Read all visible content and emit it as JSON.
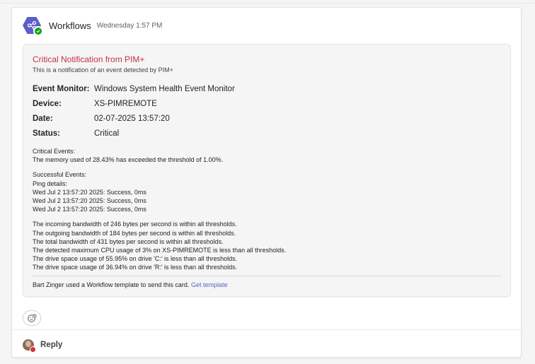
{
  "message": {
    "sender": "Workflows",
    "timestamp": "Wednesday 1:57 PM",
    "icons": {
      "avatar": "workflow-share-icon",
      "presence": "available-check-icon"
    }
  },
  "card": {
    "title": "Critical Notification from PIM+",
    "subtitle": "This is a notification of an event detected by PIM+",
    "facts": [
      {
        "label": "Event Monitor:",
        "value": "Windows System Health Event Monitor"
      },
      {
        "label": "Device:",
        "value": "XS-PIMREMOTE"
      },
      {
        "label": "Date:",
        "value": "02-07-2025 13:57:20"
      },
      {
        "label": "Status:",
        "value": "Critical"
      }
    ],
    "critical_events": [
      "Critical Events:",
      "The memory used of 28.43% has exceeded the threshold of 1.00%."
    ],
    "successful_events": [
      "Successful Events:",
      "Ping details:",
      "Wed Jul 2 13:57:20 2025: Success, 0ms",
      "Wed Jul 2 13:57:20 2025: Success, 0ms",
      "Wed Jul 2 13:57:20 2025: Success, 0ms"
    ],
    "threshold_lines": [
      "The incoming bandwidth of 246 bytes per second is within all thresholds.",
      "The outgoing bandwidth of 184 bytes per second is within all thresholds.",
      "The total bandwidth of 431 bytes per second is within all thresholds.",
      "The detected maximum CPU usage of 3% on XS-PIMREMOTE is less than all thresholds.",
      "The drive space usage of 55.95% on drive 'C:' is less than all thresholds.",
      "The drive space usage of 36.94% on drive 'R:' is less than all thresholds."
    ],
    "footer_text": "Bart Zinger used a Workflow template to send this card.",
    "footer_link": "Get template"
  },
  "reactions": {
    "icon": "add-reaction-icon"
  },
  "reply": {
    "label": "Reply"
  },
  "colors": {
    "accent": "#5b5fc7",
    "critical": "#c4314b",
    "available": "#13a10e",
    "busy": "#d13438"
  }
}
